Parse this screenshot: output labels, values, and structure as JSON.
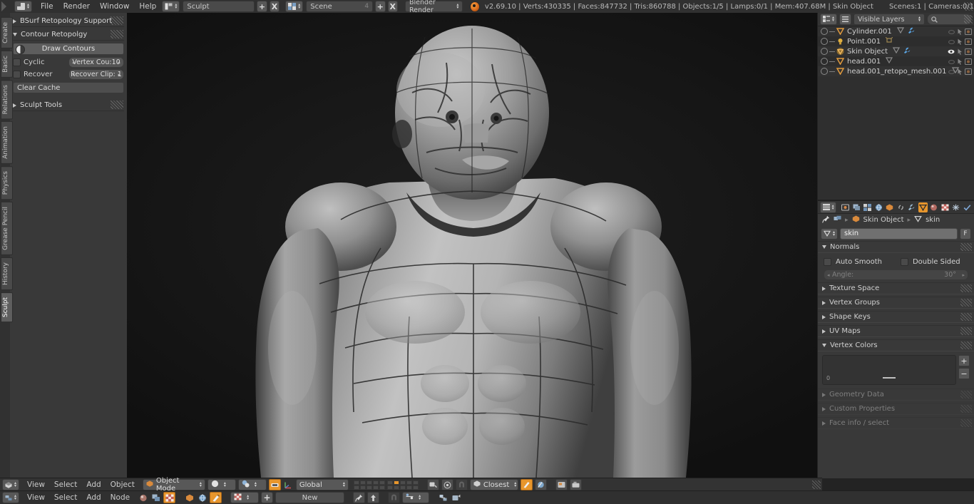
{
  "topbar": {
    "menus": [
      "File",
      "Render",
      "Window",
      "Help"
    ],
    "screen_layout": "Sculpt",
    "scene_name": "Scene",
    "scene_count": "4",
    "engine": "Blender Render",
    "add_label": "+",
    "remove_label": "X",
    "stats": "v2.69.10 | Verts:430335 | Faces:847732 | Tris:860788 | Objects:1/5 | Lamps:0/1 | Mem:407.68M | Skin Object",
    "stats_right": "Scenes:1 | Cameras:0/1"
  },
  "toolshelf": {
    "tabs": [
      "Create",
      "Basic",
      "Relations",
      "Animation",
      "Physics",
      "Grease Pencil",
      "History",
      "Sculpt"
    ],
    "active_tab": "Sculpt",
    "panels": [
      {
        "title": "BSurf Retopology Support",
        "open": false
      },
      {
        "title": "Contour Retopolgy",
        "open": true
      },
      {
        "title": "Sculpt Tools",
        "open": false
      }
    ],
    "draw_contours_label": "Draw Contours",
    "cyclic_label": "Cyclic",
    "recover_label": "Recover",
    "vertex_count_label": "Vertex Cou:10",
    "recover_clip_label": "Recover Clip: 1",
    "clear_cache_label": "Clear Cache"
  },
  "outliner": {
    "display_mode": "Visible Layers",
    "search_placeholder": "",
    "rows": [
      {
        "name": "Cylinder.001",
        "icon": "mesh-triangle-icon",
        "extra": [
          "mesh-data-icon",
          "wrench-icon"
        ],
        "visible": false
      },
      {
        "name": "Point.001",
        "icon": "lamp-icon",
        "extra": [
          "lamp-data-icon"
        ],
        "visible": false
      },
      {
        "name": "Skin Object",
        "icon": "mesh-selected-icon",
        "extra": [
          "mesh-data-icon",
          "wrench-icon"
        ],
        "visible": true
      },
      {
        "name": "head.001",
        "icon": "mesh-triangle-icon",
        "extra": [
          "mesh-data-icon"
        ],
        "visible": false
      },
      {
        "name": "head.001_retopo_mesh.001",
        "icon": "mesh-triangle-icon",
        "extra": [
          "mesh-data-icon"
        ],
        "visible": false
      }
    ]
  },
  "properties": {
    "tabs": [
      "render-icon",
      "render-layers-icon",
      "scene-icon",
      "world-icon",
      "object-icon",
      "constraints-icon",
      "modifiers-icon",
      "object-data-icon",
      "material-icon",
      "texture-icon",
      "physics-icon",
      "particles-icon"
    ],
    "active_tab_index": 7,
    "breadcrumb_object": "Skin Object",
    "breadcrumb_data": "skin",
    "datablock_name": "skin",
    "fake_user_label": "F",
    "sections": [
      {
        "title": "Normals",
        "open": true
      },
      {
        "title": "Texture Space",
        "open": false
      },
      {
        "title": "Vertex Groups",
        "open": false
      },
      {
        "title": "Shape Keys",
        "open": false
      },
      {
        "title": "UV Maps",
        "open": false
      },
      {
        "title": "Vertex Colors",
        "open": true
      },
      {
        "title": "Geometry Data",
        "open": false
      },
      {
        "title": "Custom Properties",
        "open": false
      },
      {
        "title": "Face info / select",
        "open": false
      }
    ],
    "auto_smooth_label": "Auto Smooth",
    "double_sided_label": "Double Sided",
    "angle_label": "Angle:",
    "angle_value": "30°",
    "vertex_colors_zero": "0",
    "add_label": "+",
    "remove_label": "−"
  },
  "viewport_header": {
    "menus": [
      "View",
      "Select",
      "Add",
      "Object"
    ],
    "mode": "Object Mode",
    "snap_mode": "Closest",
    "transform_orientation": "Global",
    "active_layer_index": 6
  },
  "node_header": {
    "menus": [
      "View",
      "Select",
      "Add",
      "Node"
    ],
    "new_label": "New"
  },
  "colors": {
    "accent_orange": "#e8962c",
    "viewport_bg": "#181818",
    "panel_bg": "#393939",
    "header_bg": "#333333",
    "outliner_bg": "#2f2f2f",
    "clay_light": "#b9b9b9",
    "clay_mid": "#8d8d8d",
    "clay_dark": "#4a4a4a"
  }
}
